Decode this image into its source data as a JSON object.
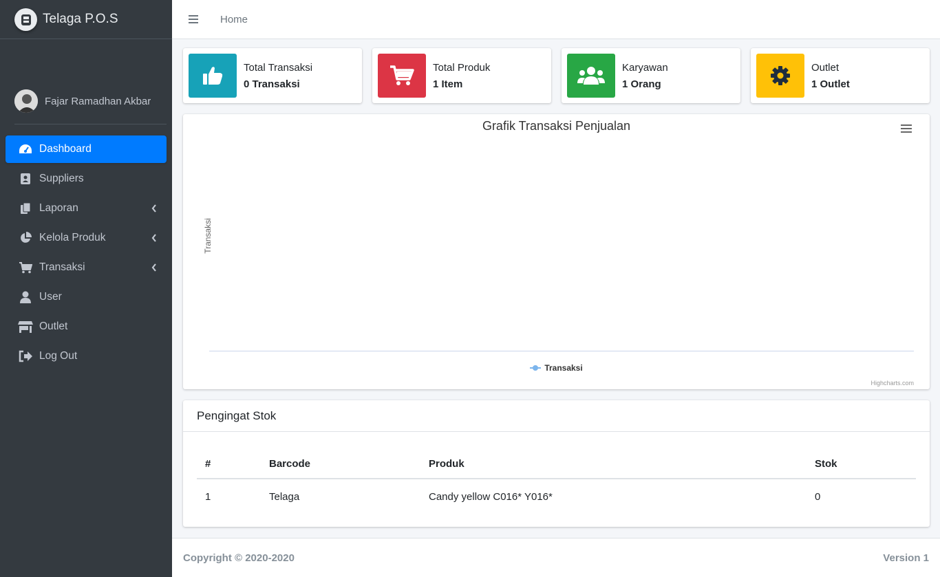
{
  "brand": {
    "name": "Telaga P.O.S"
  },
  "user": {
    "name": "Fajar Ramadhan Akbar"
  },
  "sidebar": {
    "items": [
      {
        "label": "Dashboard",
        "icon": "tachometer-icon",
        "active": true
      },
      {
        "label": "Suppliers",
        "icon": "address-book-icon"
      },
      {
        "label": "Laporan",
        "icon": "copy-icon",
        "has_children": true
      },
      {
        "label": "Kelola Produk",
        "icon": "pie-chart-icon",
        "has_children": true
      },
      {
        "label": "Transaksi",
        "icon": "shopping-cart-icon",
        "has_children": true
      },
      {
        "label": "User",
        "icon": "user-icon"
      },
      {
        "label": "Outlet",
        "icon": "store-icon"
      },
      {
        "label": "Log Out",
        "icon": "sign-out-icon"
      }
    ]
  },
  "topbar": {
    "home": "Home"
  },
  "info_boxes": [
    {
      "label": "Total Transaksi",
      "value": "0 Transaksi",
      "color": "#17a2b8",
      "icon": "thumbs-up-icon"
    },
    {
      "label": "Total Produk",
      "value": "1 Item",
      "color": "#dc3545",
      "icon": "shopping-cart-icon"
    },
    {
      "label": "Karyawan",
      "value": "1 Orang",
      "color": "#28a745",
      "icon": "users-icon"
    },
    {
      "label": "Outlet",
      "value": "1 Outlet",
      "color": "#ffc107",
      "icon": "gear-icon"
    }
  ],
  "chart_data": {
    "type": "line",
    "title": "Grafik Transaksi Penjualan",
    "ylabel": "Transaksi",
    "xlabel": "",
    "series": [
      {
        "name": "Transaksi",
        "values": []
      }
    ],
    "categories": [],
    "legend": "bottom-center",
    "credits": "Highcharts.com"
  },
  "stock": {
    "title": "Pengingat Stok",
    "columns": [
      "#",
      "Barcode",
      "Produk",
      "Stok"
    ],
    "rows": [
      [
        "1",
        "Telaga",
        "Candy yellow C016* Y016*",
        "0"
      ]
    ]
  },
  "footer": {
    "copyright": "Copyright © 2020-2020",
    "version": "Version 1"
  },
  "colors": {
    "sidebar": "#343a40",
    "accent": "#007bff"
  }
}
